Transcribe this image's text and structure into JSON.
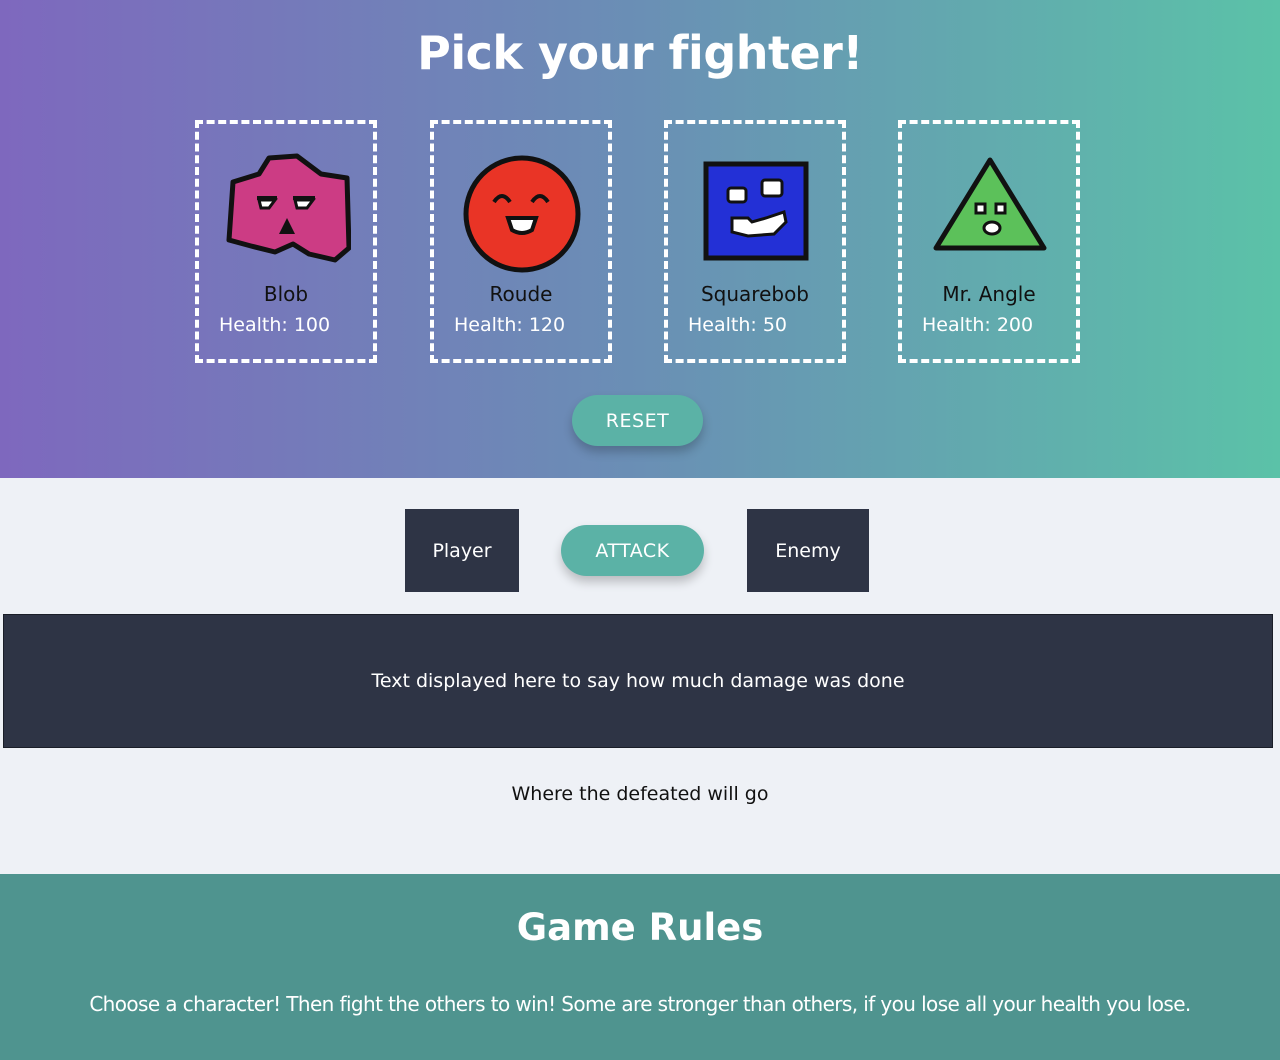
{
  "header": {
    "title": "Pick your fighter!"
  },
  "fighters": [
    {
      "name": "Blob",
      "health_label": "Health: 100",
      "icon": "blob-icon",
      "color": "#cc3c84"
    },
    {
      "name": "Roude",
      "health_label": "Health: 120",
      "icon": "circle-face-icon",
      "color": "#e93426"
    },
    {
      "name": "Squarebob",
      "health_label": "Health: 50",
      "icon": "square-face-icon",
      "color": "#2330d6"
    },
    {
      "name": "Mr. Angle",
      "health_label": "Health: 200",
      "icon": "triangle-face-icon",
      "color": "#5cc15a"
    }
  ],
  "controls": {
    "reset_label": "RESET",
    "attack_label": "ATTACK"
  },
  "arena": {
    "player_label": "Player",
    "enemy_label": "Enemy",
    "log_text": "Text displayed here to say how much damage was done",
    "defeated_text": "Where the defeated will go"
  },
  "rules": {
    "title": "Game Rules",
    "text": "Choose a character! Then fight the others to win! Some are stronger than others, if you lose all your health you lose."
  },
  "colors": {
    "gradient_start": "#7e68be",
    "gradient_end": "#5bc2a8",
    "button": "#5bb2a6",
    "dark_panel": "#2e3445",
    "rules_bg": "#4f948f"
  }
}
